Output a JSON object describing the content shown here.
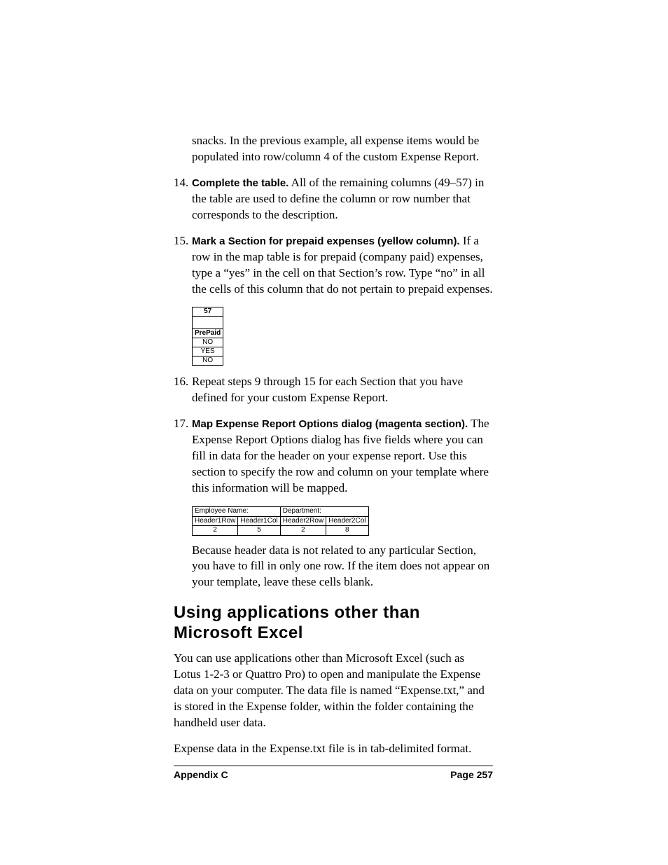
{
  "intro": "snacks. In the previous example, all expense items would be populated into row/column 4 of the custom Expense Report.",
  "items": [
    {
      "num": "14.",
      "lead": "Complete the table.",
      "text": " All of the remaining columns (49–57) in the table are used to define the column or row number that corresponds to the description."
    },
    {
      "num": "15.",
      "lead": "Mark a Section for prepaid expenses (yellow column).",
      "text": " If a row in the map table is for prepaid (company paid) expenses, type a “yes” in the cell on that Section’s row. Type “no” in all the cells of this column that do not pertain to prepaid expenses."
    },
    {
      "num": "16.",
      "lead": "",
      "text": "Repeat steps 9 through 15 for each Section that you have defined for your custom Expense Report."
    },
    {
      "num": "17.",
      "lead": "Map Expense Report Options dialog (magenta section).",
      "text": " The Expense Report Options dialog has five fields where you can fill in data for the header on your expense report. Use this section to specify the row and column on your template where this information will be mapped."
    }
  ],
  "prepaid_table": {
    "col_header": "57",
    "row_header": "PrePaid",
    "rows": [
      "NO",
      "YES",
      "NO"
    ]
  },
  "header_map_table": {
    "top": [
      "Employee Name:",
      "Department:"
    ],
    "headers": [
      "Header1Row",
      "Header1Col",
      "Header2Row",
      "Header2Col"
    ],
    "values": [
      "2",
      "5",
      "2",
      "8"
    ]
  },
  "after17": "Because header data is not related to any particular Section, you have to fill in only one row. If the item does not appear on your template, leave these cells blank.",
  "heading": "Using applications other than Microsoft Excel",
  "para1": "You can use applications other than Microsoft Excel (such as Lotus 1-2-3 or Quattro Pro) to open and manipulate the Expense data on your computer. The data file is named “Expense.txt,” and is stored in the Expense folder, within the folder containing the handheld user data.",
  "para2": "Expense data in the Expense.txt file is in tab-delimited format.",
  "footer": {
    "left": "Appendix C",
    "right": "Page 257"
  }
}
